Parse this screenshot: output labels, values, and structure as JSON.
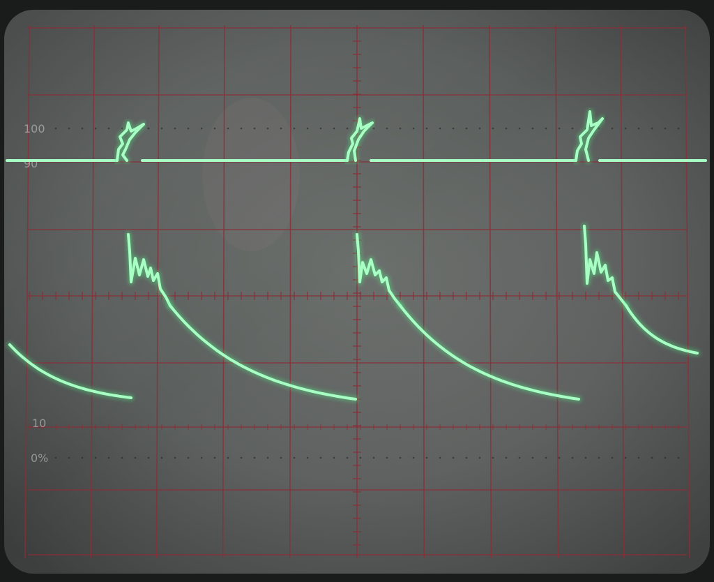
{
  "graticule": {
    "labels": [
      "100",
      "90",
      "10",
      "0%"
    ],
    "grid_color": "#8a2f38",
    "dot_color": "#2a2a2a"
  },
  "trace": {
    "color": "#a8ffc4",
    "glow": "#4dff88"
  },
  "screen": {
    "face_color": "#5a5f5d",
    "bezel_color": "#202221"
  }
}
